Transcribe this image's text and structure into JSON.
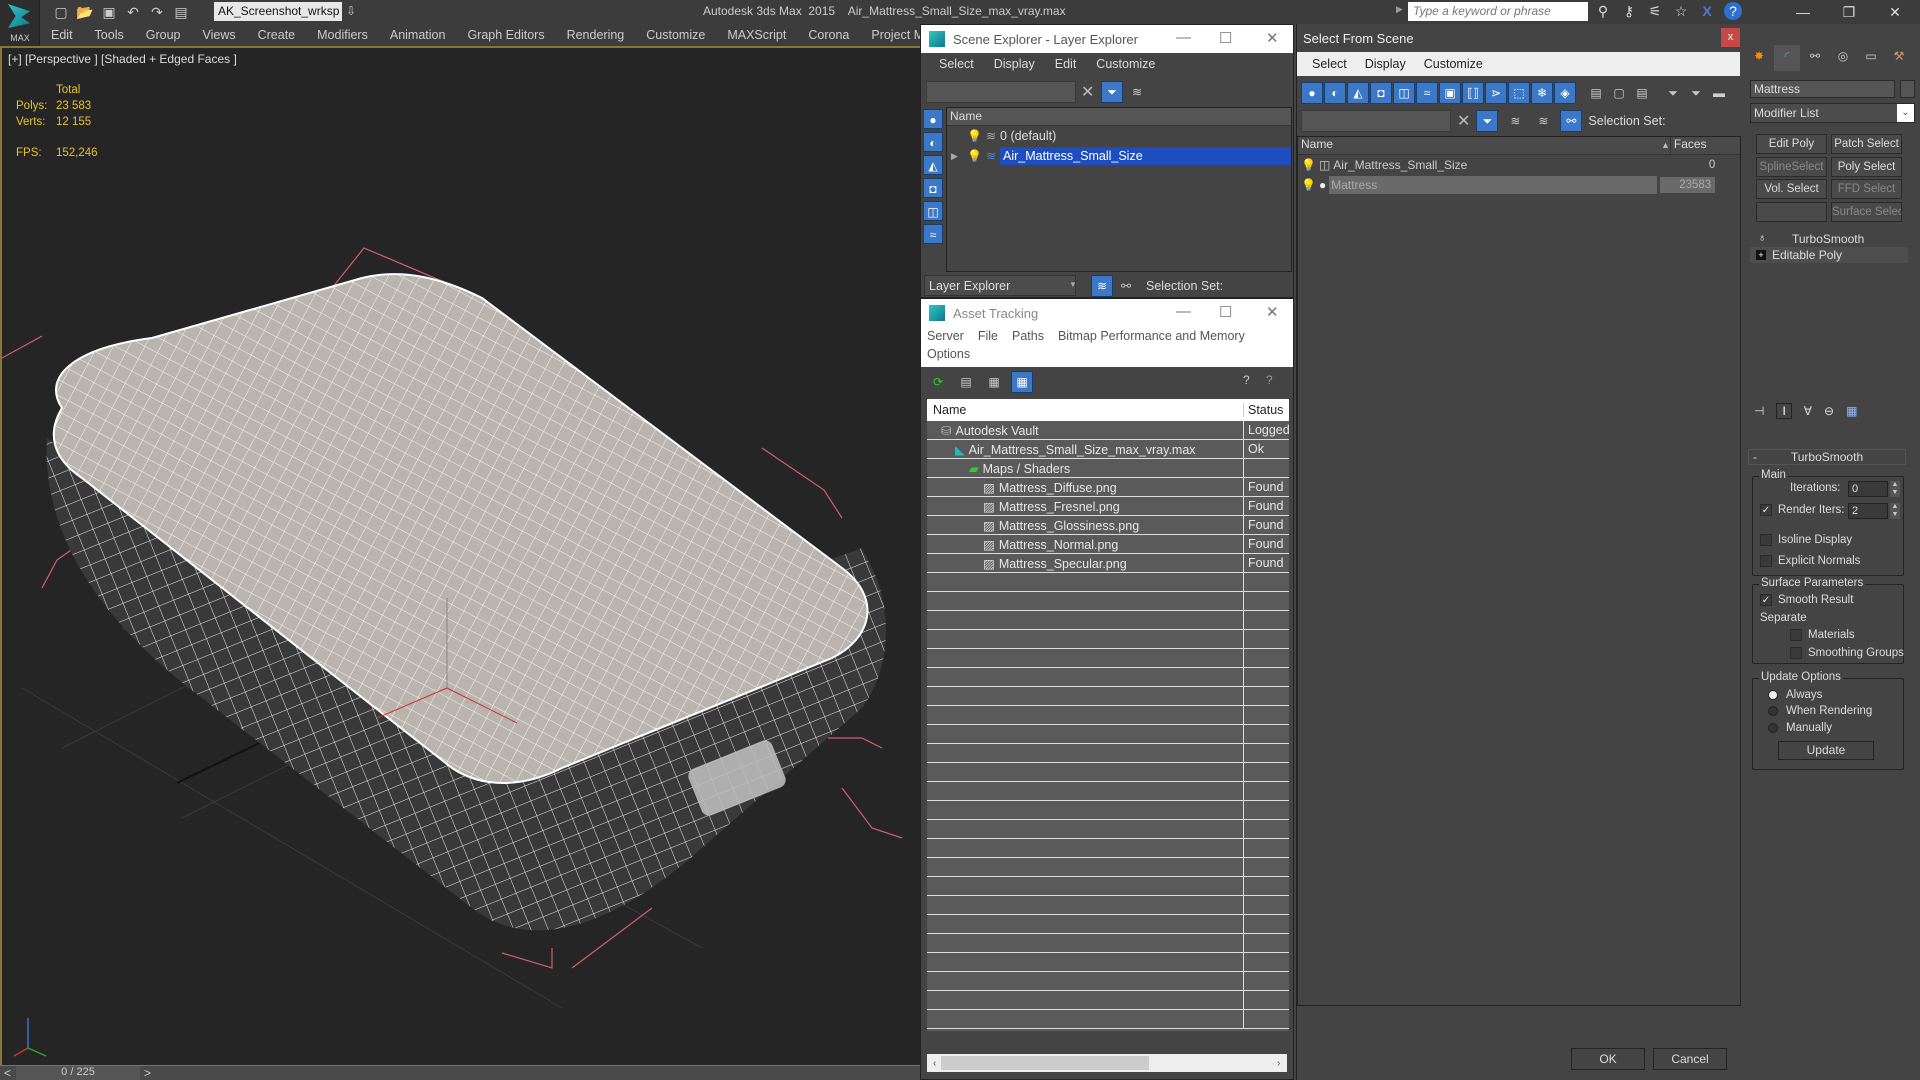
{
  "app": {
    "logo_label": "MAX",
    "workspace": "AK_Screenshot_wrksp",
    "title": "Autodesk 3ds Max  2015    Air_Mattress_Small_Size_max_vray.max",
    "search_placeholder": "Type a keyword or phrase",
    "menu": [
      "Edit",
      "Tools",
      "Group",
      "Views",
      "Create",
      "Modifiers",
      "Animation",
      "Graph Editors",
      "Rendering",
      "Customize",
      "MAXScript",
      "Corona",
      "Project Mana"
    ]
  },
  "viewport": {
    "label": "[+] [Perspective ] [Shaded + Edged Faces ]",
    "stats": {
      "header": "Total",
      "polys_label": "Polys:",
      "polys": "23 583",
      "verts_label": "Verts:",
      "verts": "12 155",
      "fps_label": "FPS:",
      "fps": "152,246"
    },
    "timeline": "0 / 225",
    "colors": {
      "background": "#252525",
      "border": "#8a7536",
      "mesh": "#b9b4ae",
      "stat_text": "#e8c32a"
    }
  },
  "scene_explorer": {
    "title": "Scene Explorer - Layer Explorer",
    "menu": [
      "Select",
      "Display",
      "Edit",
      "Customize"
    ],
    "column": "Name",
    "layers": [
      {
        "name": "0 (default)",
        "selected": false
      },
      {
        "name": "Air_Mattress_Small_Size",
        "selected": true
      }
    ],
    "footer_dropdown": "Layer Explorer",
    "selection_set": "Selection Set:"
  },
  "asset_tracking": {
    "title": "Asset Tracking",
    "menu": [
      "Server",
      "File",
      "Paths",
      "Bitmap Performance and Memory",
      "Options"
    ],
    "columns": [
      "Name",
      "Status"
    ],
    "rows": [
      {
        "name": "Autodesk Vault",
        "status": "Logged",
        "indent": 1,
        "icon": "vault-icon"
      },
      {
        "name": "Air_Mattress_Small_Size_max_vray.max",
        "status": "Ok",
        "indent": 2,
        "icon": "max-file-icon"
      },
      {
        "name": "Maps / Shaders",
        "status": "",
        "indent": 3,
        "icon": "maps-icon"
      },
      {
        "name": "Mattress_Diffuse.png",
        "status": "Found",
        "indent": 4,
        "icon": "image-file-icon"
      },
      {
        "name": "Mattress_Fresnel.png",
        "status": "Found",
        "indent": 4,
        "icon": "image-file-icon"
      },
      {
        "name": "Mattress_Glossiness.png",
        "status": "Found",
        "indent": 4,
        "icon": "image-file-icon"
      },
      {
        "name": "Mattress_Normal.png",
        "status": "Found",
        "indent": 4,
        "icon": "image-file-icon"
      },
      {
        "name": "Mattress_Specular.png",
        "status": "Found",
        "indent": 4,
        "icon": "image-file-icon"
      }
    ]
  },
  "select_from_scene": {
    "title": "Select From Scene",
    "menu": [
      "Select",
      "Display",
      "Customize"
    ],
    "selection_set": "Selection Set:",
    "columns": [
      "Name",
      "Faces"
    ],
    "rows": [
      {
        "name": "Air_Mattress_Small_Size",
        "faces": "0",
        "selected": false
      },
      {
        "name": "Mattress",
        "faces": "23583",
        "selected": true
      }
    ],
    "ok": "OK",
    "cancel": "Cancel"
  },
  "command_panel": {
    "object_name": "Mattress",
    "modifier_list": "Modifier List",
    "buttons": [
      "Edit Poly",
      "Patch Select",
      "SplineSelect",
      "Poly Select",
      "Vol. Select",
      "FFD Select",
      "",
      "Surface Select"
    ],
    "stack": [
      "TurboSmooth",
      "Editable Poly"
    ],
    "rollout": "TurboSmooth",
    "main_group": "Main",
    "iterations_label": "Iterations:",
    "iterations": "0",
    "render_iters_label": "Render Iters:",
    "render_iters": "2",
    "render_iters_checked": true,
    "isoline": "Isoline Display",
    "explicit_normals": "Explicit Normals",
    "surface_group": "Surface Parameters",
    "smooth_result": "Smooth Result",
    "separate": "Separate",
    "materials": "Materials",
    "smoothing_groups": "Smoothing Groups",
    "update_group": "Update Options",
    "always": "Always",
    "when_rendering": "When Rendering",
    "manually": "Manually",
    "update_btn": "Update"
  }
}
